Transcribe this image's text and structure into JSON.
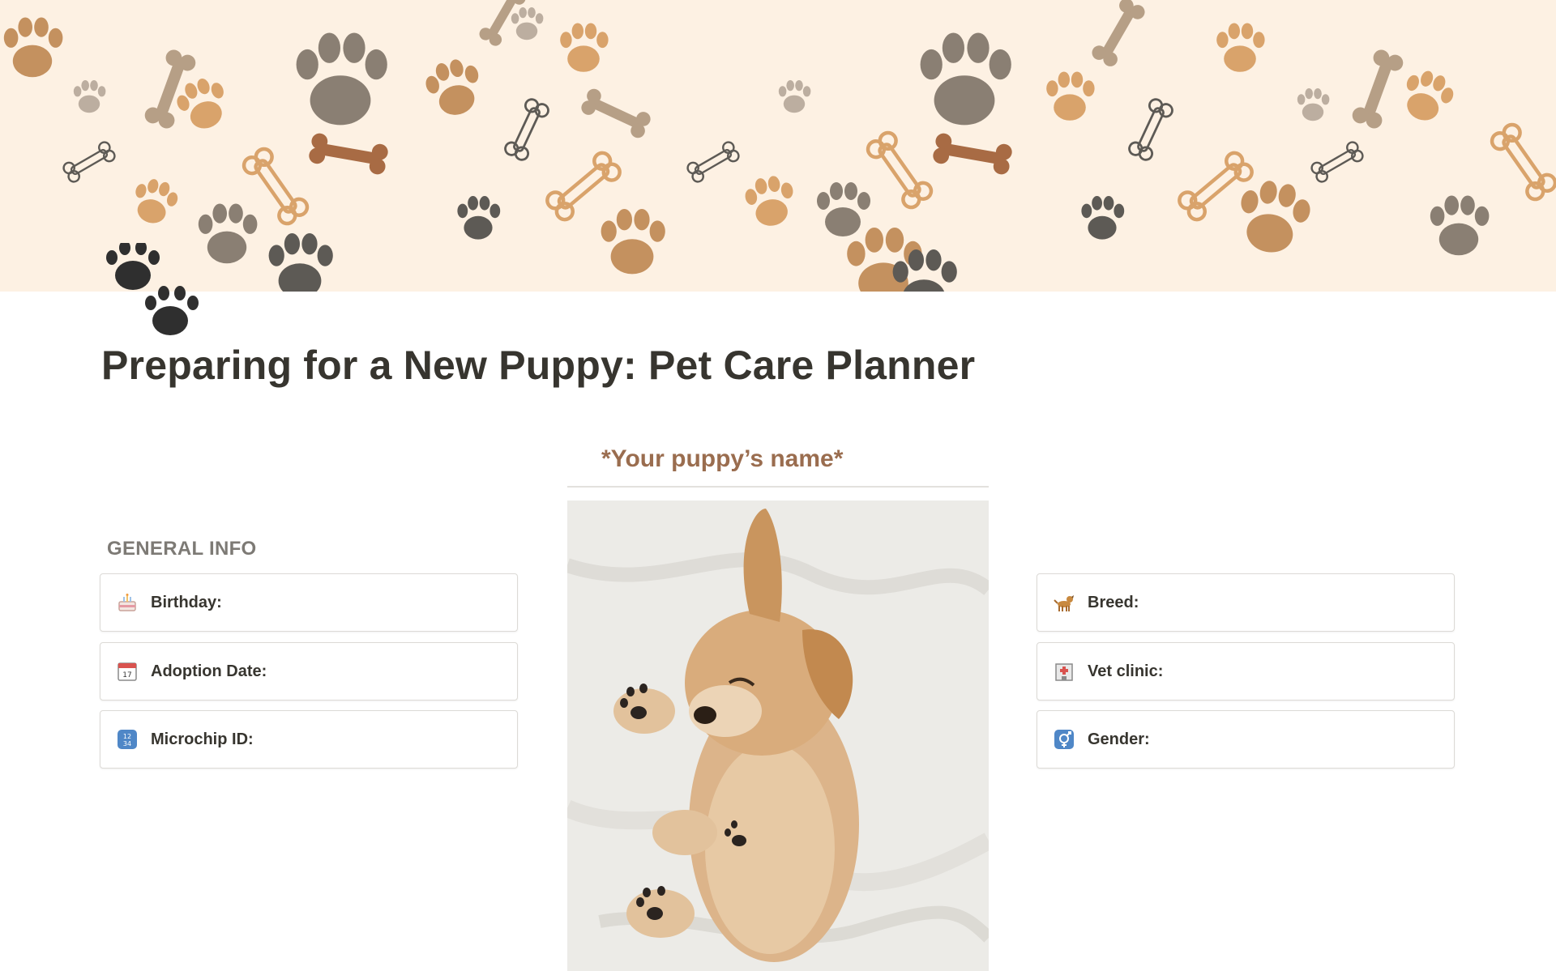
{
  "page": {
    "title": "Preparing for a New Puppy: Pet Care Planner",
    "icon": "paw-prints-icon"
  },
  "cover": {
    "pattern": "paws-and-bones",
    "colors": [
      "#fdf1e3",
      "#c4915f",
      "#8a7f73",
      "#d9a36b",
      "#5d5a55"
    ]
  },
  "center": {
    "puppy_name": "*Your puppy’s name*",
    "photo": "sleeping-golden-retriever-puppy-photo"
  },
  "general_info": {
    "heading": "GENERAL INFO",
    "left": [
      {
        "icon": "birthday-cake-icon",
        "label": "Birthday:"
      },
      {
        "icon": "calendar-icon",
        "label": "Adoption Date:"
      },
      {
        "icon": "numbers-1234-icon",
        "label": "Microchip ID:"
      }
    ],
    "right": [
      {
        "icon": "dog-icon",
        "label": "Breed:"
      },
      {
        "icon": "hospital-icon",
        "label": "Vet clinic:"
      },
      {
        "icon": "gender-symbol-icon",
        "label": "Gender:"
      }
    ]
  },
  "colors": {
    "title_text": "#37352f",
    "heading_text": "#7d7a75",
    "puppy_name_text": "#9a6d4f",
    "card_border": "#dcdad6"
  }
}
